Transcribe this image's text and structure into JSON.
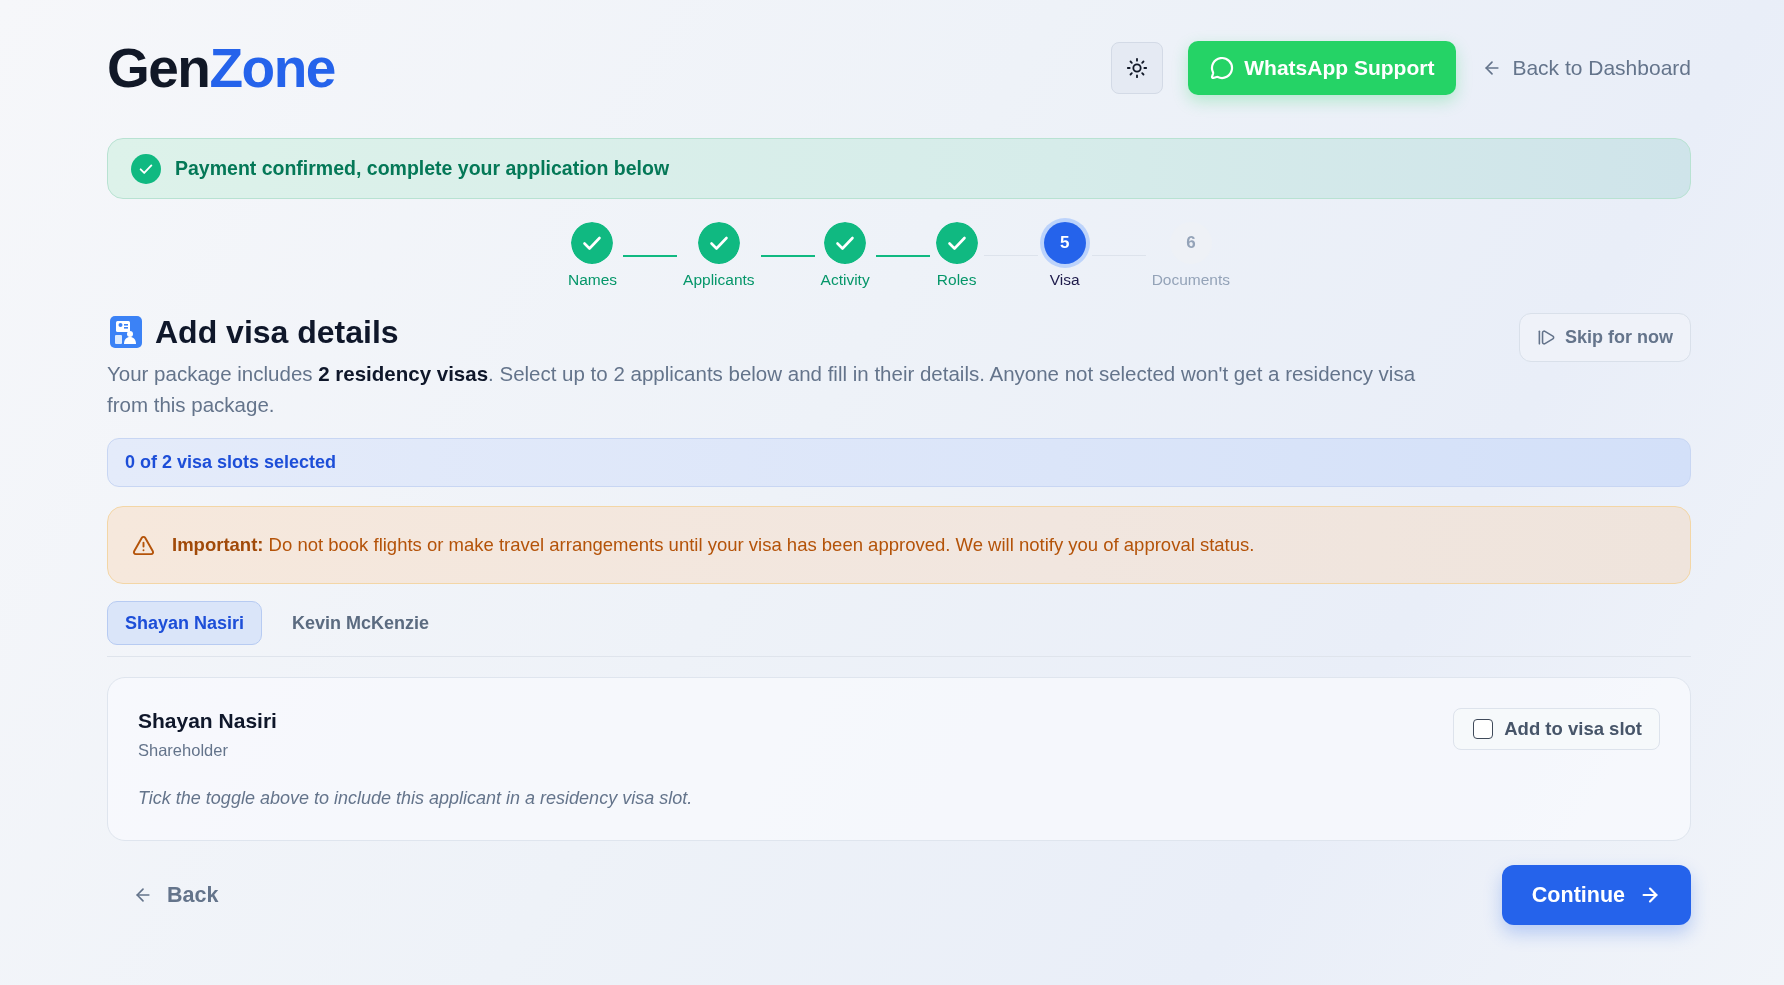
{
  "header": {
    "logo": {
      "lead": "Gen",
      "tail": "Zone"
    },
    "support_button": "WhatsApp Support",
    "back_link": "Back to Dashboard"
  },
  "banner": {
    "text": "Payment confirmed, complete your application below"
  },
  "steps": [
    {
      "label": "Names",
      "done": true,
      "selected": false
    },
    {
      "label": "Applicants",
      "done": true,
      "selected": false
    },
    {
      "label": "Activity",
      "done": true,
      "selected": false
    },
    {
      "label": "Roles",
      "done": true,
      "selected": false
    },
    {
      "number": "5",
      "label": "Visa",
      "done": false,
      "selected": true
    },
    {
      "number": "6",
      "label": "Documents",
      "done": false,
      "selected": false
    }
  ],
  "section": {
    "title": "Add visa details",
    "skip_button": "Skip for now",
    "intro": "Your package includes **2 residency visas**. Select up to 2 applicants below and fill in their details. Anyone not selected won't get a residency visa from this package."
  },
  "slots": {
    "text": "0 of 2 visa slots selected"
  },
  "notice": {
    "text": "**Important:** Do not book flights or make travel arrangements until your visa has been approved. We will notify you of approval status."
  },
  "tabs": [
    {
      "label": "Shayan Nasiri",
      "selected": true
    },
    {
      "label": "Kevin McKenzie",
      "selected": false
    }
  ],
  "applicant": {
    "name": "Shayan Nasiri",
    "role": "Shareholder",
    "toggle": {
      "label": "Add to visa slot",
      "checked": false
    },
    "note": "Tick the toggle above to include this applicant in a residency visa slot."
  },
  "footer": {
    "back_button": "Back",
    "continue_button": "Continue"
  }
}
